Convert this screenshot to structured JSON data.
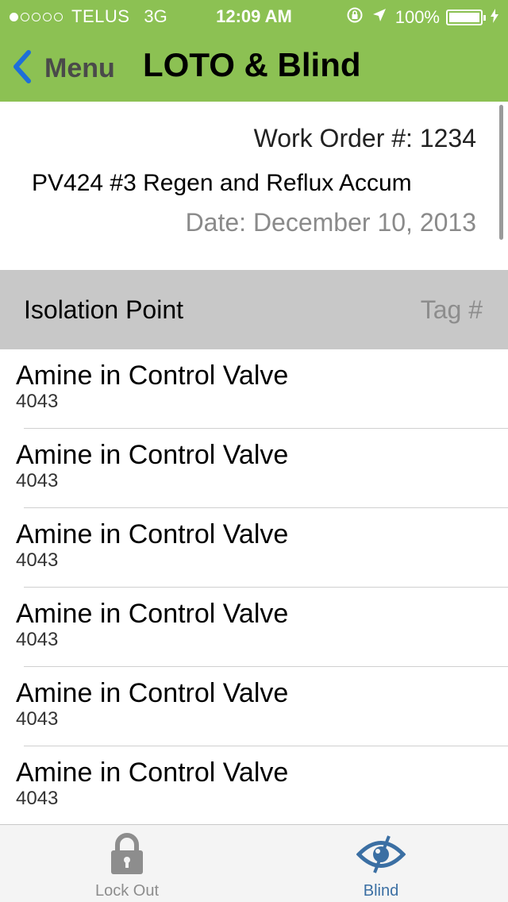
{
  "status_bar": {
    "carrier": "TELUS",
    "network": "3G",
    "time": "12:09 AM",
    "battery": "100%",
    "signal_bars": 1,
    "signal_total": 5
  },
  "nav": {
    "back_label": "Menu",
    "title": "LOTO & Blind"
  },
  "info": {
    "work_order": "Work Order #: 1234",
    "description": "PV424 #3 Regen and Reflux Accum",
    "date": "Date: December 10, 2013"
  },
  "section_header": {
    "column1": "Isolation Point",
    "column2": "Tag #"
  },
  "rows": [
    {
      "title": "Amine in Control Valve",
      "subtitle": "4043"
    },
    {
      "title": "Amine in Control Valve",
      "subtitle": "4043"
    },
    {
      "title": "Amine in Control Valve",
      "subtitle": "4043"
    },
    {
      "title": "Amine in Control Valve",
      "subtitle": "4043"
    },
    {
      "title": "Amine in Control Valve",
      "subtitle": "4043"
    },
    {
      "title": "Amine in Control Valve",
      "subtitle": "4043"
    }
  ],
  "tabs": [
    {
      "label": "Lock Out",
      "icon": "lock-icon",
      "selected": false
    },
    {
      "label": "Blind",
      "icon": "eye-icon",
      "selected": true
    }
  ],
  "colors": {
    "nav_bar": "#8cc153",
    "back_chevron": "#1e6fd9",
    "section_header": "#c8c8c8",
    "tab_selected": "#3b6fa3",
    "tab_unselected": "#8d8d8d"
  }
}
